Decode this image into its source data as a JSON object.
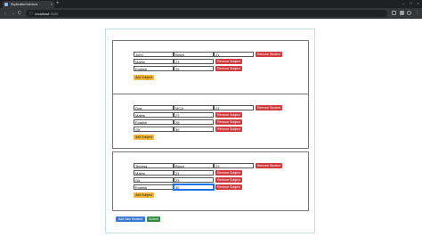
{
  "browser": {
    "tab_title": "ReplicationSchema",
    "tab_close": "×",
    "new_tab": "+",
    "back": "←",
    "forward": "→",
    "reload": "C",
    "lock_icon": "ⓘ",
    "host": "localhost",
    "port": ":3000",
    "menu": "⋮",
    "window_controls": [
      "–",
      "□",
      "×"
    ]
  },
  "students": [
    {
      "name": "John",
      "surname": "Blach",
      "age": "21",
      "remove_student_label": "Remove Student",
      "subjects": [
        {
          "name": "Maths",
          "marks": "23",
          "remove_label": "Remove Subject"
        },
        {
          "name": "English",
          "marks": "25",
          "remove_label": "Remove Subject"
        }
      ],
      "add_subject_label": "Add Subject"
    },
    {
      "name": "Doe",
      "surname": "MCA",
      "age": "24",
      "remove_student_label": "Remove Student",
      "subjects": [
        {
          "name": "Maths",
          "marks": "27",
          "remove_label": "Remove Subject"
        },
        {
          "name": "English",
          "marks": "28",
          "remove_label": "Remove Subject"
        },
        {
          "name": "GK",
          "marks": "30",
          "remove_label": "Remove Subject"
        }
      ],
      "add_subject_label": "Add Subject"
    },
    {
      "name": "Terresa",
      "surname": "Blach",
      "age": "23",
      "remove_student_label": "Remove Student",
      "subjects": [
        {
          "name": "Maths",
          "marks": "21",
          "remove_label": "Remove Subject"
        },
        {
          "name": "Gk",
          "marks": "23",
          "remove_label": "Remove Subject"
        },
        {
          "name": "English",
          "marks": "30",
          "remove_label": "Remove Subject"
        }
      ],
      "add_subject_label": "Add Subject"
    }
  ],
  "footer": {
    "add_student_label": "Add New Student",
    "submit_label": "Submit"
  },
  "colors": {
    "remove_button": "#d13a3d",
    "add_subject_button": "#f1b43c",
    "add_student_button": "#3c78d0",
    "submit_button": "#2e8a45"
  }
}
